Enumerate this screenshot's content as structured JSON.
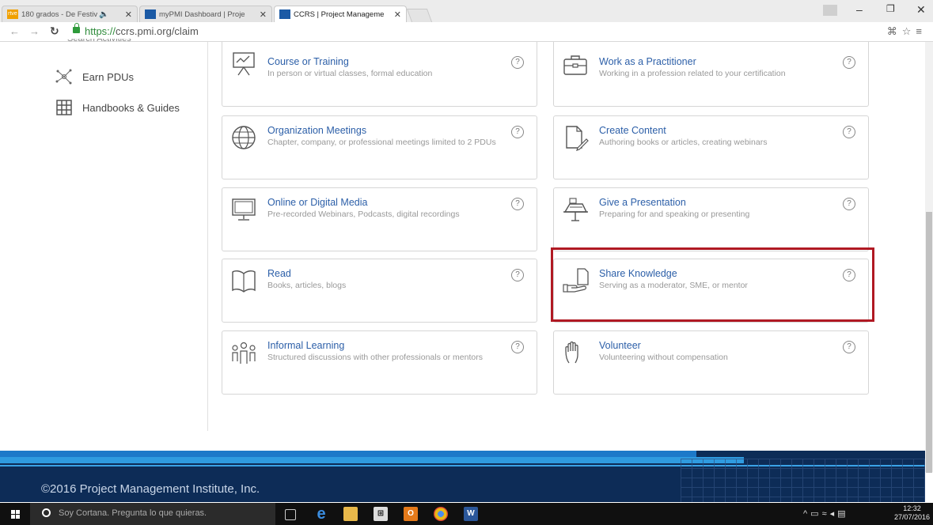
{
  "browser": {
    "tabs": [
      {
        "label": "180 grados - De Festiv",
        "favicon_text": "rtve"
      },
      {
        "label": "myPMI Dashboard | Proje",
        "favicon_text": ""
      },
      {
        "label": "CCRS | Project Manageme",
        "favicon_text": ""
      }
    ],
    "url_protocol": "https://",
    "url_rest": "ccrs.pmi.org/claim"
  },
  "sidebar": {
    "clipped_label": "Search Activities",
    "items": [
      {
        "label": "Earn PDUs",
        "icon": "network-icon"
      },
      {
        "label": "Handbooks & Guides",
        "icon": "grid-icon"
      }
    ]
  },
  "cards": [
    {
      "title": "Course or Training",
      "desc": "In person or virtual classes, formal education",
      "icon": "presentation-board-icon"
    },
    {
      "title": "Work as a Practitioner",
      "desc": "Working in a profession related to your certification",
      "icon": "briefcase-icon"
    },
    {
      "title": "Organization Meetings",
      "desc": "Chapter, company, or professional meetings limited to 2 PDUs",
      "icon": "globe-icon"
    },
    {
      "title": "Create Content",
      "desc": "Authoring books or articles, creating webinars",
      "icon": "document-pen-icon"
    },
    {
      "title": "Online or Digital Media",
      "desc": "Pre-recorded Webinars, Podcasts, digital recordings",
      "icon": "monitor-icon"
    },
    {
      "title": "Give a Presentation",
      "desc": "Preparing for and speaking or presenting",
      "icon": "podium-icon"
    },
    {
      "title": "Read",
      "desc": "Books, articles, blogs",
      "icon": "open-book-icon"
    },
    {
      "title": "Share Knowledge",
      "desc": "Serving as a moderator, SME, or mentor",
      "icon": "hand-document-icon"
    },
    {
      "title": "Informal Learning",
      "desc": "Structured discussions with other professionals or mentors",
      "icon": "people-group-icon"
    },
    {
      "title": "Volunteer",
      "desc": "Volunteering without compensation",
      "icon": "raised-hand-icon"
    }
  ],
  "help_glyph": "?",
  "footer": {
    "copyright": "©2016 Project Management Institute, Inc."
  },
  "taskbar": {
    "cortana_placeholder": "Soy Cortana. Pregunta lo que quieras.",
    "time": "12:32",
    "date": "27/07/2016"
  },
  "colors": {
    "link": "#2c5fa8",
    "highlight": "#b01923",
    "footer_bg": "#0d2c57"
  }
}
